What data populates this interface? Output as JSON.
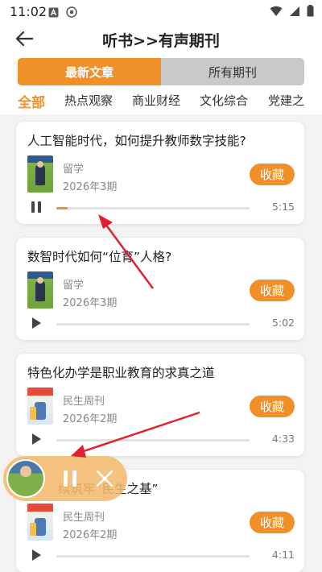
{
  "status_bar": {
    "time": "11:02"
  },
  "header": {
    "title": "听书>>有声期刊"
  },
  "segments": [
    {
      "label": "最新文章",
      "active": true
    },
    {
      "label": "所有期刊",
      "active": false
    }
  ],
  "categories": [
    {
      "label": "全部",
      "active": true
    },
    {
      "label": "热点观察",
      "active": false
    },
    {
      "label": "商业财经",
      "active": false
    },
    {
      "label": "文化综合",
      "active": false
    },
    {
      "label": "党建之",
      "active": false
    }
  ],
  "articles": [
    {
      "title": "人工智能时代，如何提升教师数字技能?",
      "magazine": "留学",
      "issue": "2026年3期",
      "favorite_label": "收藏",
      "duration": "5:15",
      "state": "pause-icon",
      "progress": 0.06
    },
    {
      "title": "数智时代如何“位育”人格?",
      "magazine": "留学",
      "issue": "2026年3期",
      "favorite_label": "收藏",
      "duration": "5:02",
      "state": "play-icon",
      "progress": 0
    },
    {
      "title": "特色化办学是职业教育的求真之道",
      "magazine": "民生周刊",
      "issue": "2026年2期",
      "favorite_label": "收藏",
      "duration": "4:33",
      "state": "play-icon",
      "progress": 0
    },
    {
      "title": "续筑牢“民生之基”",
      "magazine": "民生周刊",
      "issue": "2026年2期",
      "favorite_label": "收藏",
      "duration": "4:11",
      "state": "play-icon",
      "progress": 0
    }
  ],
  "colors": {
    "accent": "#f09028",
    "annotation": "#e02030"
  }
}
